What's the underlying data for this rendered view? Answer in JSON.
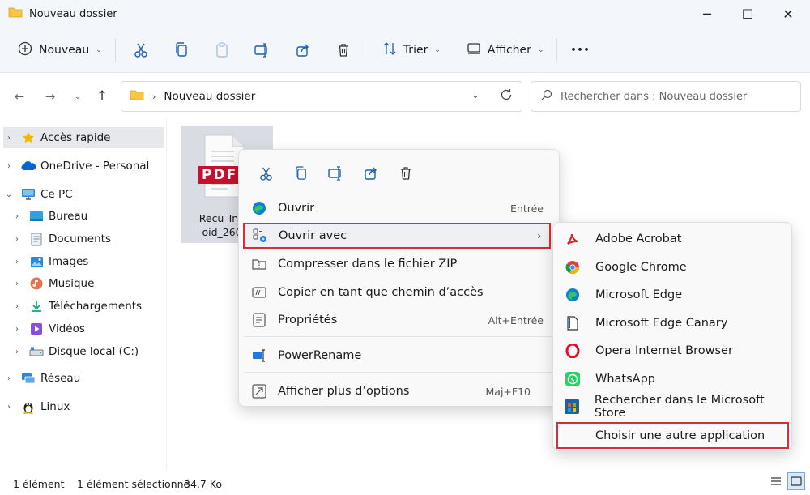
{
  "window": {
    "title": "Nouveau dossier",
    "controls": {
      "minimize": "─",
      "maximize": "☐",
      "close": "✕"
    }
  },
  "toolbar": {
    "new_label": "Nouveau",
    "sort_label": "Trier",
    "view_label": "Afficher",
    "more_label": "•••"
  },
  "address": {
    "crumb": "Nouveau dossier",
    "search_placeholder": "Rechercher dans : Nouveau dossier"
  },
  "sidebar": {
    "items": [
      {
        "label": "Accès rapide"
      },
      {
        "label": "OneDrive - Personal"
      },
      {
        "label": "Ce PC"
      },
      {
        "label": "Bureau"
      },
      {
        "label": "Documents"
      },
      {
        "label": "Images"
      },
      {
        "label": "Musique"
      },
      {
        "label": "Téléchargements"
      },
      {
        "label": "Vidéos"
      },
      {
        "label": "Disque local (C:)"
      },
      {
        "label": "Réseau"
      },
      {
        "label": "Linux"
      }
    ]
  },
  "file": {
    "badge": "PDF",
    "name_line1": "Recu_Info2",
    "name_line2": "oid_2609."
  },
  "context_menu": {
    "items": [
      {
        "label": "Ouvrir",
        "accel": "Entrée"
      },
      {
        "label": "Ouvrir avec",
        "accel": ""
      },
      {
        "label": "Compresser dans le fichier ZIP",
        "accel": ""
      },
      {
        "label": "Copier en tant que chemin d’accès",
        "accel": ""
      },
      {
        "label": "Propriétés",
        "accel": "Alt+Entrée"
      },
      {
        "label": "PowerRename",
        "accel": ""
      },
      {
        "label": "Afficher plus d’options",
        "accel": "Maj+F10"
      }
    ]
  },
  "open_with": {
    "items": [
      {
        "label": "Adobe Acrobat"
      },
      {
        "label": "Google Chrome"
      },
      {
        "label": "Microsoft Edge"
      },
      {
        "label": "Microsoft Edge Canary"
      },
      {
        "label": "Opera Internet Browser"
      },
      {
        "label": "WhatsApp"
      },
      {
        "label": "Rechercher dans le Microsoft Store"
      },
      {
        "label": "Choisir une autre application"
      }
    ]
  },
  "status": {
    "count": "1 élément",
    "selected": "1 élément sélectionné",
    "size": "34,7 Ko"
  },
  "colors": {
    "accent_red": "#d32f3a",
    "chrome_bg": "#f3f6fb",
    "folder_yellow": "#f8c545",
    "pdf_red": "#c8102e"
  }
}
